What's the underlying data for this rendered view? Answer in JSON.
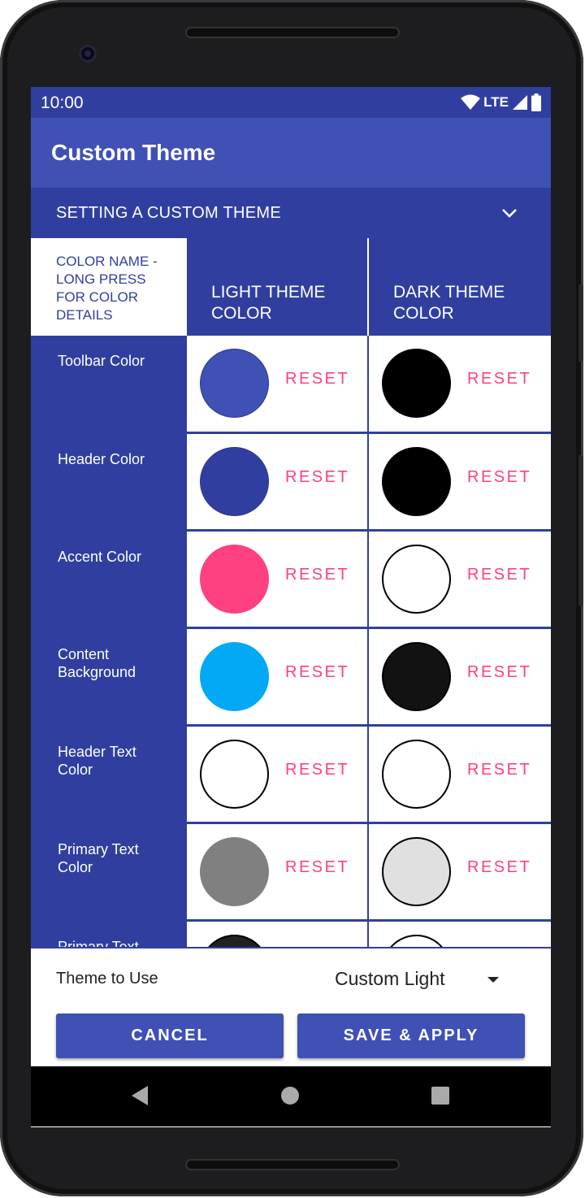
{
  "status": {
    "time": "10:00",
    "network": "LTE"
  },
  "appbar": {
    "title": "Custom Theme"
  },
  "section": {
    "title": "SETTING A CUSTOM THEME"
  },
  "table": {
    "headers": {
      "name": "COLOR NAME - LONG PRESS FOR COLOR DETAILS",
      "light": "LIGHT THEME COLOR",
      "dark": "DARK THEME COLOR"
    },
    "reset_label": "RESET",
    "rows": [
      {
        "name": "Toolbar Color",
        "light": "#3f51b5",
        "dark": "#000000"
      },
      {
        "name": "Header Color",
        "light": "#303f9f",
        "dark": "#000000"
      },
      {
        "name": "Accent Color",
        "light": "#ff4081",
        "dark": "#ffffff"
      },
      {
        "name": "Content Background",
        "light": "#03a9f4",
        "dark": "#121212"
      },
      {
        "name": "Header Text Color",
        "light": "#ffffff",
        "dark": "#ffffff"
      },
      {
        "name": "Primary Text Color",
        "light": "#808080",
        "dark": "#e0e0e0"
      },
      {
        "name": "Primary Text -",
        "light": "#212121",
        "dark": "#ffffff"
      }
    ]
  },
  "bottom": {
    "theme_label": "Theme to Use",
    "theme_value": "Custom Light",
    "cancel_label": "CANCEL",
    "save_label": "SAVE & APPLY"
  },
  "colors": {
    "primary": "#3f51b5",
    "primary_dark": "#303f9f",
    "accent": "#ff4081"
  }
}
